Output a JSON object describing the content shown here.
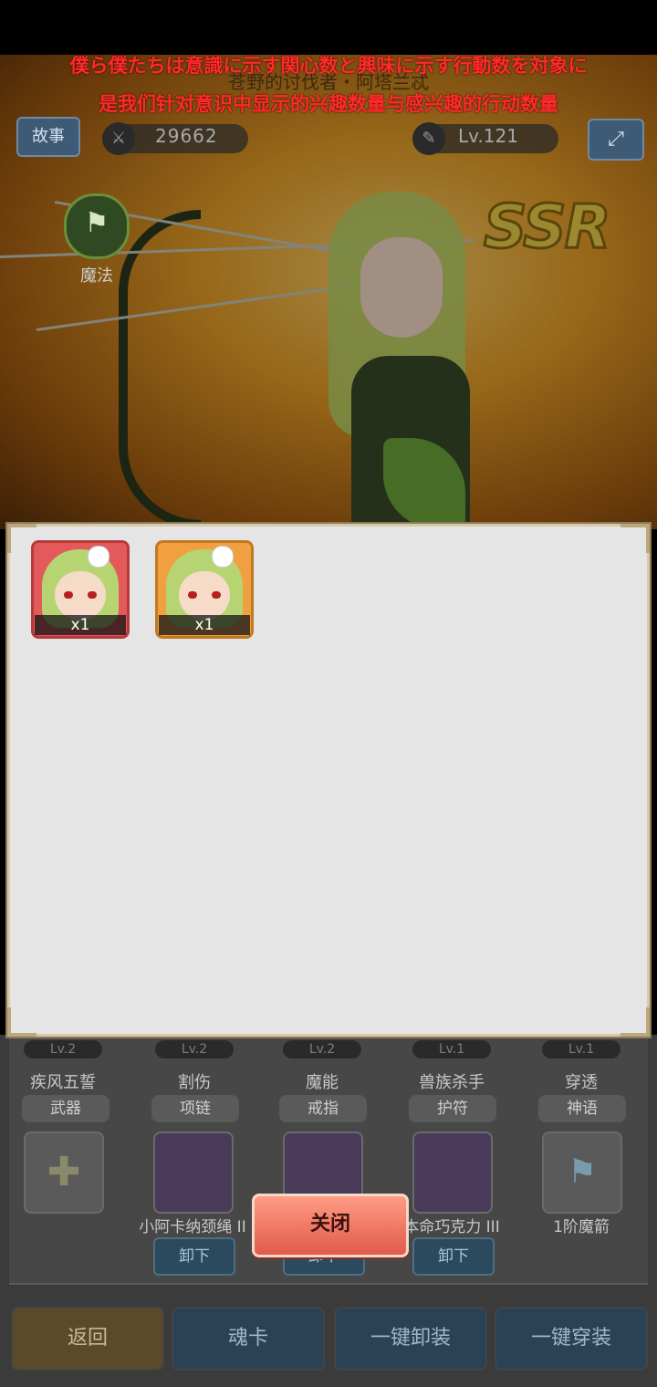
{
  "subtitles": {
    "line1": "僕ら僕たちは意識に示す関心数と興味に示す行動数を対象に",
    "line2": "是我们针对意识中显示的兴趣数量与感兴趣的行动数量"
  },
  "hero": {
    "title": "苍野的讨伐者・阿塔兰忒",
    "rarity": "SSR",
    "power": "29662",
    "level": "Lv.121",
    "story_label": "故事",
    "skill_label": "魔法"
  },
  "equipment": {
    "slots": [
      {
        "lv": "Lv.2",
        "name": "疾风五誓",
        "type": "武器",
        "item": "",
        "unequip": ""
      },
      {
        "lv": "Lv.2",
        "name": "割伤",
        "type": "项链",
        "item": "小阿卡纳颈绳 II",
        "unequip": "卸下"
      },
      {
        "lv": "Lv.2",
        "name": "魔能",
        "type": "戒指",
        "item": "",
        "unequip": "卸下"
      },
      {
        "lv": "Lv.1",
        "name": "兽族杀手",
        "type": "护符",
        "item": "本命巧克力 III",
        "unequip": "卸下"
      },
      {
        "lv": "Lv.1",
        "name": "穿透",
        "type": "神语",
        "item": "1阶魔箭",
        "unequip": ""
      }
    ]
  },
  "bottom_bar": {
    "back": "返回",
    "soul_card": "魂卡",
    "unequip_all": "一键卸装",
    "equip_all": "一键穿装"
  },
  "modal": {
    "cards": [
      {
        "count": "x1",
        "frame_color": "#e25a5a"
      },
      {
        "count": "x1",
        "frame_color": "#f0a040"
      }
    ],
    "close_label": "关闭"
  }
}
